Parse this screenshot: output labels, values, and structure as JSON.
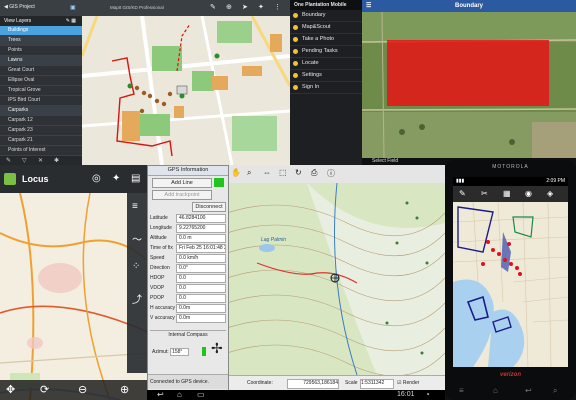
{
  "panel_layers": {
    "back_label": "GIS Project",
    "title": "MapIt GIS/KD Professional",
    "view_layers": "View Layers",
    "layers": [
      {
        "label": "Buildings",
        "kind": "sel"
      },
      {
        "label": "Trees",
        "kind": "group"
      },
      {
        "label": "Points",
        "kind": ""
      },
      {
        "label": "Lawns",
        "kind": "group"
      },
      {
        "label": "Great Court",
        "kind": ""
      },
      {
        "label": "Ellipse Oval",
        "kind": ""
      },
      {
        "label": "Tropical Grove",
        "kind": ""
      },
      {
        "label": "IPS Bird Court",
        "kind": ""
      },
      {
        "label": "Carparks",
        "kind": "group"
      },
      {
        "label": "Carpark 12",
        "kind": ""
      },
      {
        "label": "Carpark 23",
        "kind": ""
      },
      {
        "label": "Carpark 21",
        "kind": ""
      },
      {
        "label": "Points of Interest",
        "kind": ""
      }
    ]
  },
  "panel_farm": {
    "app_name": "One Plantation Mobile",
    "title": "Boundary",
    "menu": [
      "Boundary",
      "Map&Scout",
      "Take a Photo",
      "Pending Tasks",
      "Locate",
      "Settings",
      "Sign In"
    ],
    "bottom_label": "Select Field"
  },
  "panel_locus": {
    "app_name": "Locus"
  },
  "gps_dialog": {
    "title": "GPS Information",
    "add_line": "Add Line",
    "add_trackpoint": "Add trackpoint",
    "disconnect": "Disconnect",
    "fields": [
      {
        "label": "Latitude",
        "value": "46.8284100"
      },
      {
        "label": "Longitude",
        "value": "9.22765200"
      },
      {
        "label": "Altitude",
        "value": "0.0 m"
      },
      {
        "label": "Time of fix",
        "value": "Fri Feb 25 16:01:48 2012"
      },
      {
        "label": "Speed",
        "value": "0.0 km/h"
      },
      {
        "label": "Direction",
        "value": "0.0°"
      },
      {
        "label": "HDOP",
        "value": "0.0"
      },
      {
        "label": "VDOP",
        "value": "0.0"
      },
      {
        "label": "PDOP",
        "value": "0.0"
      },
      {
        "label": "H accuracy",
        "value": "0.0m"
      },
      {
        "label": "V accuracy",
        "value": "0.0m"
      }
    ],
    "compass_label": "Internal Compass",
    "azimut_label": "Azimut",
    "azimut_value": "158°",
    "status": "Connected to GPS device."
  },
  "panel_topo": {
    "coordinate_label": "Coordinate:",
    "coordinate_value": "729563,186184",
    "scale_label": "Scale",
    "scale_value": "1:5311342",
    "render_label": "Render",
    "lake_label": "Lag Palmin"
  },
  "panel_phone": {
    "brand": "MOTOROLA",
    "time": "2:09 PM",
    "carrier": "verizon"
  },
  "taskbar": {
    "clock": "16:01"
  },
  "colors": {
    "farm_boundary": "#e61414",
    "farm_title_bar": "#2c5aa0",
    "layers_selected": "#4aa3df"
  }
}
